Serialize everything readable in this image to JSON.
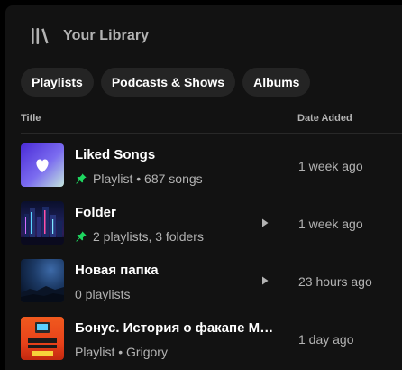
{
  "header": {
    "title": "Your Library",
    "icon": "library-icon"
  },
  "filters": [
    {
      "label": "Playlists"
    },
    {
      "label": "Podcasts & Shows"
    },
    {
      "label": "Albums"
    }
  ],
  "columns": {
    "title": "Title",
    "date_added": "Date Added"
  },
  "items": [
    {
      "title": "Liked Songs",
      "type": "Playlist",
      "meta": "687 songs",
      "pinned": true,
      "date": "1 week ago"
    },
    {
      "title": "Folder",
      "meta": "2 playlists, 3 folders",
      "pinned": true,
      "folder": true,
      "date": "1 week ago"
    },
    {
      "title": "Новая папка",
      "meta": "0 playlists",
      "folder": true,
      "date": "23 hours ago"
    },
    {
      "title": "Бонус. История о факапе Максима",
      "type": "Playlist",
      "meta": "Grigory",
      "date": "1 day ago"
    }
  ],
  "colors": {
    "accent": "#1ed760",
    "text_secondary": "#b3b3b3",
    "background": "#121212",
    "chip": "#242424"
  }
}
